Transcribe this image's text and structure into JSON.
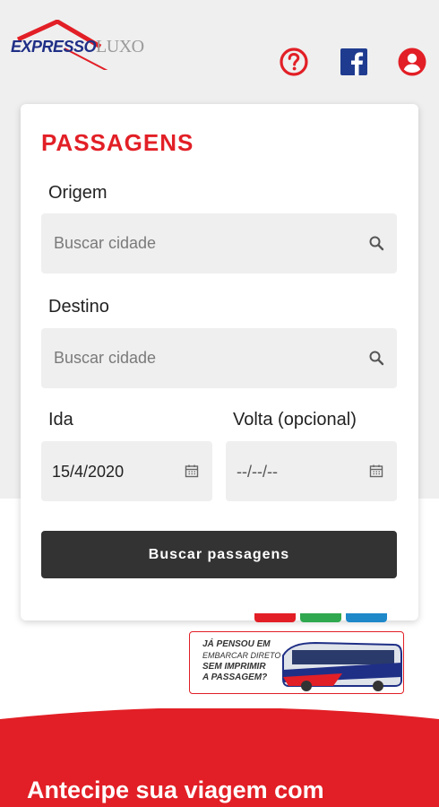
{
  "header": {
    "logo_part1": "EXPRESSO",
    "logo_part2": "LUXO",
    "icons": [
      "help-icon",
      "facebook-icon",
      "user-icon"
    ]
  },
  "search": {
    "title": "PASSAGENS",
    "origin_label": "Origem",
    "origin_placeholder": "Buscar cidade",
    "destination_label": "Destino",
    "destination_placeholder": "Buscar cidade",
    "departure_label": "Ida",
    "departure_value": "15/4/2020",
    "return_label": "Volta (opcional)",
    "return_value": "--/--/--",
    "submit_label": "Buscar passagens"
  },
  "banner": {
    "line1": "JÁ PENSOU EM",
    "line2": "EMBARCAR DIRETO",
    "line3": "SEM IMPRIMIR",
    "line4": "A PASSAGEM?"
  },
  "promo": {
    "headline": "Antecipe sua viagem com"
  },
  "colors": {
    "brand_red": "#e21f26",
    "brand_blue": "#1f2f86",
    "button_dark": "#333333",
    "field_bg": "#efefef",
    "strip_red": "#e21f26",
    "strip_green": "#2fa84f",
    "strip_blue": "#1e88c9"
  }
}
